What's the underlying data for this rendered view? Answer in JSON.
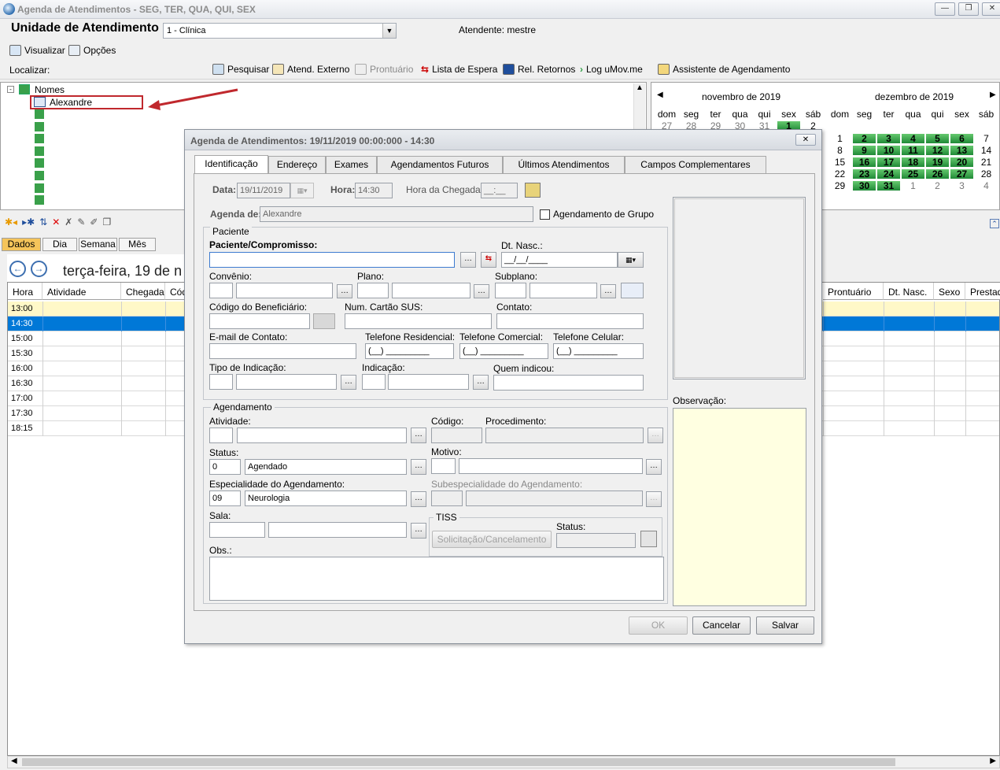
{
  "window": {
    "title": "Agenda de Atendimentos - SEG, TER, QUA, QUI, SEX"
  },
  "header": {
    "unit_label": "Unidade de Atendimento",
    "unit_value": "1 - Clínica",
    "attendant": "Atendente: mestre"
  },
  "menu": {
    "visualizar": "Visualizar",
    "opcoes": "Opções"
  },
  "toolbar": {
    "localizar": "Localizar:",
    "pesquisar": "Pesquisar",
    "atend_externo": "Atend. Externo",
    "prontuario": "Prontuário",
    "lista_espera": "Lista de Espera",
    "rel_retornos": "Rel. Retornos",
    "log_umov": "Log uMov.me",
    "assistente": "Assistente de Agendamento"
  },
  "tree": {
    "root": "Nomes",
    "selected": "Alexandre"
  },
  "calendar": {
    "months": [
      "novembro de 2019",
      "dezembro de 2019"
    ],
    "weekdays": [
      "dom",
      "seg",
      "ter",
      "qua",
      "qui",
      "sex",
      "sáb"
    ],
    "nov_row": [
      "27",
      "28",
      "29",
      "30",
      "31",
      "1",
      "2"
    ],
    "dec_rows": [
      [
        "1",
        "2",
        "3",
        "4",
        "5",
        "6",
        "7"
      ],
      [
        "8",
        "9",
        "10",
        "11",
        "12",
        "13",
        "14"
      ],
      [
        "15",
        "16",
        "17",
        "18",
        "19",
        "20",
        "21"
      ],
      [
        "22",
        "23",
        "24",
        "25",
        "26",
        "27",
        "28"
      ],
      [
        "29",
        "30",
        "31",
        "1",
        "2",
        "3",
        "4"
      ]
    ]
  },
  "view_tabs": [
    "Dados",
    "Dia",
    "Semana",
    "Mês"
  ],
  "date_title": "terça-feira, 19 de n",
  "grid": {
    "columns_left": [
      "Hora",
      "Atividade",
      "Chegada",
      "Cód"
    ],
    "columns_right": [
      "Prontuário",
      "Dt. Nasc.",
      "Sexo",
      "Prestad"
    ],
    "times": [
      "13:00",
      "14:30",
      "15:00",
      "15:30",
      "16:00",
      "16:30",
      "17:00",
      "17:30",
      "18:15"
    ]
  },
  "dialog": {
    "title": "Agenda de Atendimentos: 19/11/2019 00:00:000 - 14:30",
    "tabs": [
      "Identificação",
      "Endereço",
      "Exames",
      "Agendamentos Futuros",
      "Últimos Atendimentos",
      "Campos Complementares"
    ],
    "data_label": "Data:",
    "data_value": "19/11/2019",
    "hora_label": "Hora:",
    "hora_value": "14:30",
    "chegada_label": "Hora da Chegada:",
    "chegada_value": "__:__",
    "agenda_label": "Agenda de:",
    "agenda_value": "Alexandre",
    "grupo_label": "Agendamento de Grupo",
    "paciente_group": "Paciente",
    "paciente_label": "Paciente/Compromisso:",
    "dtnasc_label": "Dt. Nasc.:",
    "dtnasc_value": "__/__/____",
    "convenio": "Convênio:",
    "plano": "Plano:",
    "subplano": "Subplano:",
    "cod_benef": "Código do Beneficiário:",
    "cartao_sus": "Num. Cartão SUS:",
    "contato": "Contato:",
    "email": "E-mail de Contato:",
    "tel_res": "Telefone Residencial:",
    "tel_com": "Telefone Comercial:",
    "tel_cel": "Telefone Celular:",
    "tel_mask": "(__) _________",
    "tipo_ind": "Tipo de Indicação:",
    "indicacao": "Indicação:",
    "quem": "Quem indicou:",
    "agend_group": "Agendamento",
    "atividade": "Atividade:",
    "codigo": "Código:",
    "procedimento": "Procedimento:",
    "status": "Status:",
    "status_code": "0",
    "status_value": "Agendado",
    "motivo": "Motivo:",
    "especialidade": "Especialidade do Agendamento:",
    "esp_code": "09",
    "esp_value": "Neurologia",
    "subesp": "Subespecialidade do Agendamento:",
    "sala": "Sala:",
    "tiss": "TISS",
    "solicitacao": "Solicitação/Cancelamento",
    "tiss_status": "Status:",
    "obs": "Obs.:",
    "observacao": "Observação:",
    "ok": "OK",
    "cancelar": "Cancelar",
    "salvar": "Salvar"
  },
  "colors": {
    "selected_row": "#0078d7",
    "highlight_row": "#fff8c8",
    "calendar_bold": "#2e9e44",
    "observacao_bg": "#ffffe1",
    "annotation_arrow": "#c0282d"
  }
}
